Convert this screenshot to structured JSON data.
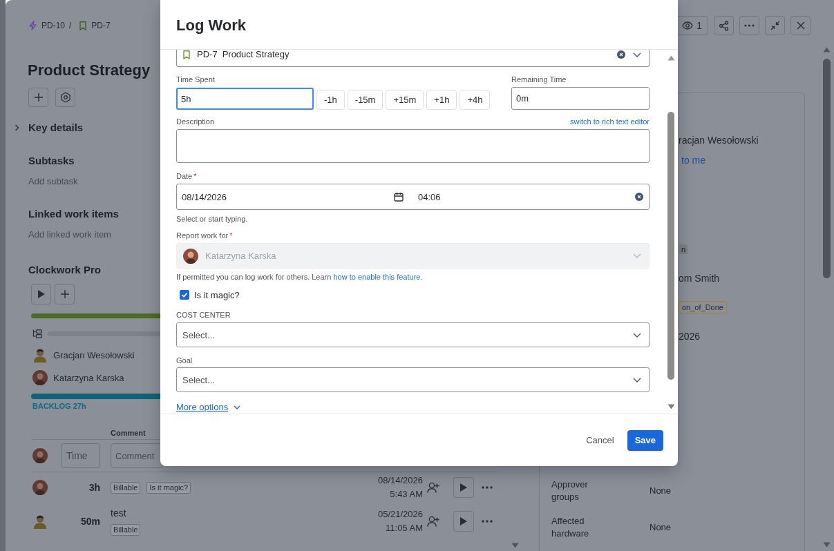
{
  "issue": {
    "breadcrumbs": [
      {
        "key": "PD-10",
        "kind": "epic"
      },
      {
        "key": "PD-7",
        "kind": "story"
      }
    ],
    "breadcrumb_separator": "/",
    "title": "Product Strategy",
    "key_details": {
      "label": "Key details",
      "expanded": false
    },
    "sections": [
      {
        "title": "Subtasks",
        "action": "Add subtask"
      },
      {
        "title": "Linked work items",
        "action": "Add linked work item"
      }
    ],
    "clockwork": {
      "title": "Clockwork Pro",
      "people": [
        {
          "name": "Gracjan Wesołowski",
          "avatar": {
            "kind": "figure"
          }
        },
        {
          "name": "Katarzyna Karska",
          "avatar": {
            "kind": "photo"
          }
        }
      ],
      "backlog": "BACKLOG 27h",
      "table": {
        "columns": [
          "Comment"
        ],
        "new_entry": {
          "avatar": {
            "kind": "photo"
          },
          "time_placeholder": "Time",
          "comment_placeholder": "Comment"
        },
        "entries": [
          {
            "avatar": {
              "kind": "photo"
            },
            "duration": "3h",
            "tags": [
              "Billable",
              "Is it magic?"
            ],
            "date": "08/14/2026",
            "time": "5:43 AM"
          },
          {
            "avatar": {
              "kind": "figure"
            },
            "duration": "50m",
            "comment": "test",
            "tags": [
              "Billable"
            ],
            "date": "05/21/2026",
            "time": "11:05 AM"
          }
        ]
      }
    },
    "toolbar": {
      "watchers": "1"
    },
    "details": {
      "visible_values": [
        {
          "kind": "person",
          "text": "racjan Wesołowski",
          "link": "to me"
        },
        {
          "kind": "tag",
          "text": "n"
        },
        {
          "kind": "text",
          "text": "om Smith"
        },
        {
          "kind": "label",
          "text": "on_of_Done"
        },
        {
          "kind": "text",
          "text": "2026"
        }
      ],
      "fields": [
        {
          "label": "Approver groups",
          "value": "None"
        },
        {
          "label": "Affected hardware",
          "value": "None"
        }
      ]
    }
  },
  "log_work": {
    "title": "Log Work",
    "work_item": {
      "key": "PD-7",
      "summary": "Product Strategy",
      "kind": "story"
    },
    "time_spent": {
      "label": "Time Spent",
      "value": "5h",
      "focused": true,
      "adjustments": [
        "-1h",
        "-15m",
        "+15m",
        "+1h",
        "+4h"
      ]
    },
    "remaining_time": {
      "label": "Remaining Time",
      "value": "0m"
    },
    "description": {
      "label": "Description",
      "editor_link": "switch to rich text editor"
    },
    "date": {
      "label": "Date",
      "required_mark": "*",
      "date": "08/14/2026",
      "time": "04:06",
      "helper": "Select or start typing."
    },
    "report_for": {
      "label": "Report work for",
      "required_mark": "*",
      "user": "Katarzyna Karska",
      "avatar": {
        "kind": "photo"
      },
      "disabled": true,
      "helper": "If permitted you can log work for others. Learn",
      "helper_link": "how to enable this feature."
    },
    "magic": {
      "label": "Is it magic?",
      "checked": true
    },
    "cost_center": {
      "label": "COST CENTER",
      "placeholder": "Select..."
    },
    "goal": {
      "label": "Goal",
      "placeholder": "Select..."
    },
    "more_options": "More options",
    "buttons": [
      {
        "label": "Cancel",
        "kind": "subtle"
      },
      {
        "label": "Save",
        "kind": "primary"
      }
    ]
  }
}
